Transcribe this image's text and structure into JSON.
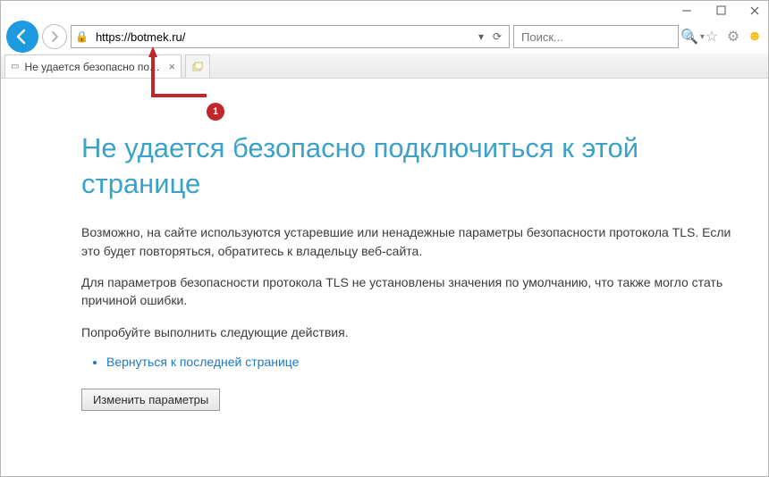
{
  "address": {
    "url": "https://botmek.ru/"
  },
  "search": {
    "placeholder": "Поиск..."
  },
  "tab": {
    "title": "Не удается безопасно под..."
  },
  "annotation": {
    "badge": "1"
  },
  "page": {
    "heading": "Не удается безопасно подключиться к этой странице",
    "paragraph1": "Возможно, на сайте используются устаревшие или ненадежные параметры безопасности протокола TLS. Если это будет повторяться, обратитесь к владельцу веб-сайта.",
    "paragraph2": "Для параметров безопасности протокола TLS не установлены значения по умолчанию, что также могло стать причиной ошибки.",
    "paragraph3": "Попробуйте выполнить следующие действия.",
    "link_text": "Вернуться к последней странице",
    "button_text": "Изменить параметры"
  }
}
